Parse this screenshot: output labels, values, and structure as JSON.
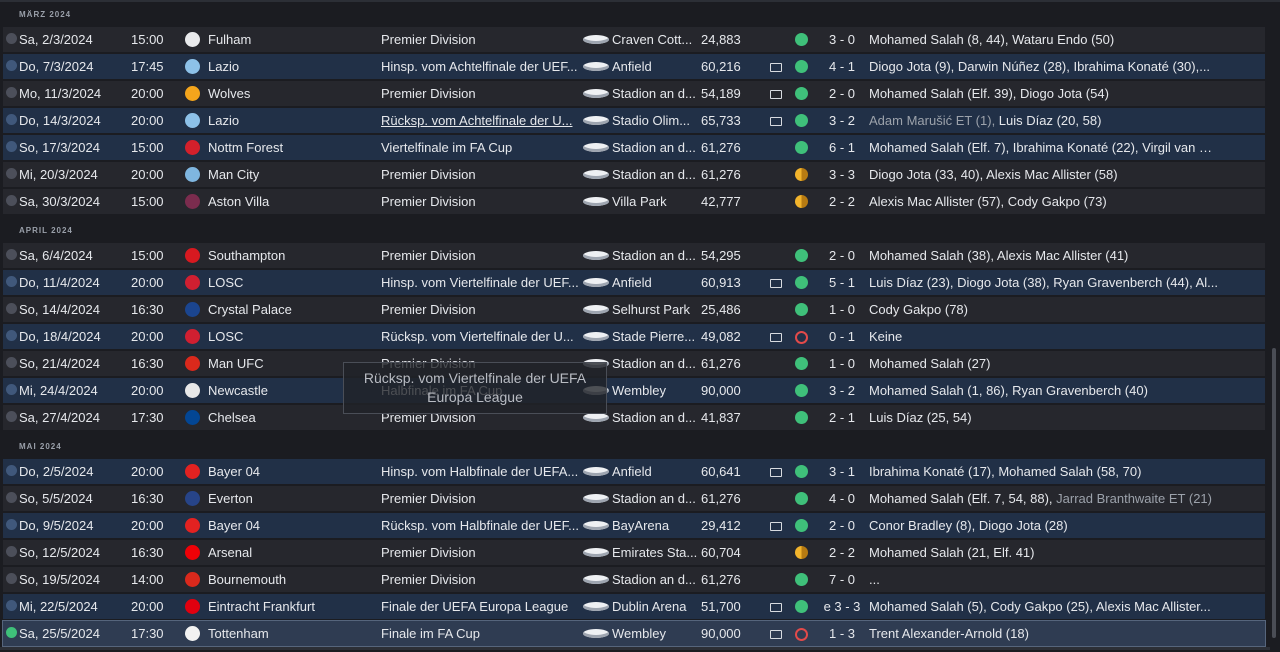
{
  "months": [
    {
      "label": "März 2024",
      "matches": [
        {
          "date": "Sa, 2/3/2024",
          "time": "15:00",
          "team": "Fulham",
          "crest": "#e9eaec",
          "comp": "Premier Division",
          "venue": "Craven Cott...",
          "att": "24,883",
          "tv": false,
          "result": "w",
          "score": "3 - 0",
          "scorers": "Mohamed Salah (8, 44), Wataru Endo (50)",
          "style": "a"
        },
        {
          "date": "Do, 7/3/2024",
          "time": "17:45",
          "team": "Lazio",
          "crest": "#8dc1e8",
          "comp": "Hinsp. vom Achtelfinale der UEF...",
          "venue": "Anfield",
          "att": "60,216",
          "tv": true,
          "result": "w",
          "score": "4 - 1",
          "scorers": "Diogo Jota (9), Darwin Núñez (28), Ibrahima Konaté (30),...",
          "style": "b"
        },
        {
          "date": "Mo, 11/3/2024",
          "time": "20:00",
          "team": "Wolves",
          "crest": "#f4a51c",
          "comp": "Premier Division",
          "venue": "Stadion an d...",
          "att": "54,189",
          "tv": true,
          "result": "w",
          "score": "2 - 0",
          "scorers": "Mohamed Salah (Elf. 39), Diogo Jota (54)",
          "style": "a"
        },
        {
          "date": "Do, 14/3/2024",
          "time": "20:00",
          "team": "Lazio",
          "crest": "#8dc1e8",
          "comp": "Rücksp. vom Achtelfinale der U...",
          "compUnderline": true,
          "venue": "Stadio Olim...",
          "att": "65,733",
          "tv": true,
          "result": "w",
          "score": "3 - 2",
          "scorersDim": "Adam Marušić ET (1), ",
          "scorers": "Luis Díaz (20, 58)",
          "style": "b"
        },
        {
          "date": "So, 17/3/2024",
          "time": "15:00",
          "team": "Nottm Forest",
          "crest": "#d3202b",
          "comp": "Viertelfinale im FA Cup",
          "venue": "Stadion an d...",
          "att": "61,276",
          "tv": false,
          "result": "w",
          "score": "6 - 1",
          "scorers": "Mohamed Salah (Elf. 7), Ibrahima Konaté (22), Virgil van Di...",
          "style": "b"
        },
        {
          "date": "Mi, 20/3/2024",
          "time": "20:00",
          "team": "Man City",
          "crest": "#7fb6e0",
          "comp": "Premier Division",
          "venue": "Stadion an d...",
          "att": "61,276",
          "tv": false,
          "result": "d",
          "score": "3 - 3",
          "scorers": "Diogo Jota (33, 40), Alexis Mac Allister (58)",
          "style": "a"
        },
        {
          "date": "Sa, 30/3/2024",
          "time": "15:00",
          "team": "Aston Villa",
          "crest": "#7b2c4e",
          "comp": "Premier Division",
          "venue": "Villa Park",
          "att": "42,777",
          "tv": false,
          "result": "d",
          "score": "2 - 2",
          "scorers": "Alexis Mac Allister (57), Cody Gakpo (73)",
          "style": "a"
        }
      ]
    },
    {
      "label": "April 2024",
      "matches": [
        {
          "date": "Sa, 6/4/2024",
          "time": "15:00",
          "team": "Southampton",
          "crest": "#d71920",
          "comp": "Premier Division",
          "venue": "Stadion an d...",
          "att": "54,295",
          "tv": false,
          "result": "w",
          "score": "2 - 0",
          "scorers": "Mohamed Salah (38), Alexis Mac Allister (41)",
          "style": "a"
        },
        {
          "date": "Do, 11/4/2024",
          "time": "20:00",
          "team": "LOSC",
          "crest": "#d01f31",
          "comp": "Hinsp. vom Viertelfinale der UEF...",
          "venue": "Anfield",
          "att": "60,913",
          "tv": true,
          "result": "w",
          "score": "5 - 1",
          "scorers": "Luis Díaz (23), Diogo Jota (38), Ryan Gravenberch (44), Al...",
          "style": "b"
        },
        {
          "date": "So, 14/4/2024",
          "time": "16:30",
          "team": "Crystal Palace",
          "crest": "#1b458f",
          "comp": "Premier Division",
          "venue": "Selhurst Park",
          "att": "25,486",
          "tv": false,
          "result": "w",
          "score": "1 - 0",
          "scorers": "Cody Gakpo (78)",
          "style": "a"
        },
        {
          "date": "Do, 18/4/2024",
          "time": "20:00",
          "team": "LOSC",
          "crest": "#d01f31",
          "comp": "Rücksp. vom Viertelfinale der U...",
          "venue": "Stade Pierre...",
          "att": "49,082",
          "tv": true,
          "result": "l",
          "score": "0 - 1",
          "scorers": "Keine",
          "style": "b"
        },
        {
          "date": "So, 21/4/2024",
          "time": "16:30",
          "team": "Man UFC",
          "crest": "#da291c",
          "comp": "Premier Division",
          "venue": "Stadion an d...",
          "att": "61,276",
          "tv": false,
          "result": "w",
          "score": "1 - 0",
          "scorers": "Mohamed Salah (27)",
          "style": "a"
        },
        {
          "date": "Mi, 24/4/2024",
          "time": "20:00",
          "team": "Newcastle",
          "crest": "#e8e8e8",
          "comp": "Halbfinale im FA Cup",
          "venue": "Wembley",
          "att": "90,000",
          "tv": false,
          "result": "w",
          "score": "3 - 2",
          "scorers": "Mohamed Salah (1, 86), Ryan Gravenberch (40)",
          "style": "b"
        },
        {
          "date": "Sa, 27/4/2024",
          "time": "17:30",
          "team": "Chelsea",
          "crest": "#034694",
          "comp": "Premier Division",
          "venue": "Stadion an d...",
          "att": "41,837",
          "tv": false,
          "result": "w",
          "score": "2 - 1",
          "scorers": "Luis Díaz (25, 54)",
          "style": "a"
        }
      ]
    },
    {
      "label": "Mai 2024",
      "matches": [
        {
          "date": "Do, 2/5/2024",
          "time": "20:00",
          "team": "Bayer 04",
          "crest": "#e32221",
          "comp": "Hinsp. vom Halbfinale der UEFA...",
          "venue": "Anfield",
          "att": "60,641",
          "tv": true,
          "result": "w",
          "score": "3 - 1",
          "scorers": "Ibrahima Konaté (17), Mohamed Salah (58, 70)",
          "style": "b"
        },
        {
          "date": "So, 5/5/2024",
          "time": "16:30",
          "team": "Everton",
          "crest": "#274488",
          "comp": "Premier Division",
          "venue": "Stadion an d...",
          "att": "61,276",
          "tv": false,
          "result": "w",
          "score": "4 - 0",
          "scorers": "Mohamed Salah (Elf. 7, 54, 88), ",
          "scorersDimAfter": "Jarrad Branthwaite ET (21)",
          "style": "a"
        },
        {
          "date": "Do, 9/5/2024",
          "time": "20:00",
          "team": "Bayer 04",
          "crest": "#e32221",
          "comp": "Rücksp. vom Halbfinale der UEF...",
          "venue": "BayArena",
          "att": "29,412",
          "tv": true,
          "result": "w",
          "score": "2 - 0",
          "scorers": "Conor Bradley (8), Diogo Jota (28)",
          "style": "b"
        },
        {
          "date": "So, 12/5/2024",
          "time": "16:30",
          "team": "Arsenal",
          "crest": "#ef0107",
          "comp": "Premier Division",
          "venue": "Emirates Sta...",
          "att": "60,704",
          "tv": false,
          "result": "d",
          "score": "2 - 2",
          "scorers": "Mohamed Salah (21, Elf. 41)",
          "style": "a"
        },
        {
          "date": "So, 19/5/2024",
          "time": "14:00",
          "team": "Bournemouth",
          "crest": "#da291c",
          "comp": "Premier Division",
          "venue": "Stadion an d...",
          "att": "61,276",
          "tv": false,
          "result": "w",
          "score": "7 - 0",
          "scorers": "...",
          "style": "a"
        },
        {
          "date": "Mi, 22/5/2024",
          "time": "20:00",
          "team": "Eintracht Frankfurt",
          "crest": "#e1000f",
          "comp": "Finale der UEFA Europa League",
          "venue": "Dublin Arena",
          "att": "51,700",
          "tv": true,
          "result": "w",
          "score": "e 3 - 3",
          "scorers": "Mohamed Salah (5), Cody Gakpo (25), Alexis Mac Allister...",
          "style": "b"
        },
        {
          "date": "Sa, 25/5/2024",
          "time": "17:30",
          "team": "Tottenham",
          "crest": "#f2f2f2",
          "comp": "Finale im FA Cup",
          "venue": "Wembley",
          "att": "90,000",
          "tv": true,
          "result": "l",
          "score": "1 - 3",
          "scorers": "Trent Alexander-Arnold (18)",
          "style": "sel"
        }
      ]
    }
  ],
  "tooltip": {
    "text": "Rücksp. vom Viertelfinale der UEFA Europa League"
  }
}
